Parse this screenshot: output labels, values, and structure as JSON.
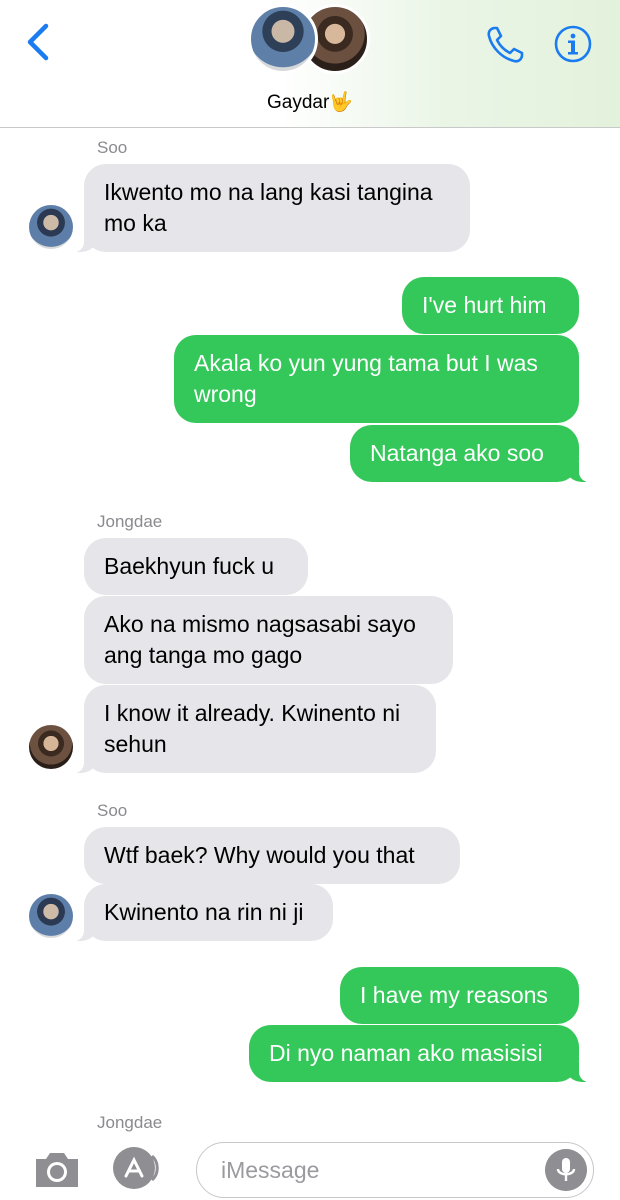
{
  "header": {
    "conversation_title": "Gaydar🤟",
    "accent_color": "#1a7cf0",
    "back_icon": "chevron-left-icon",
    "call_icon": "phone-icon",
    "details_icon": "info-icon"
  },
  "messages": [
    {
      "sender": "Soo"
    },
    {
      "text": "Ikwento mo na lang kasi tangina\nmo ka"
    },
    {
      "text": "I've hurt him"
    },
    {
      "text": "Akala ko yun yung tama but I was\nwrong"
    },
    {
      "text": "Natanga ako soo"
    },
    {
      "sender": "Jongdae"
    },
    {
      "text": "Baekhyun fuck u"
    },
    {
      "text": "Ako na mismo nagsasabi sayo\nang tanga mo gago"
    },
    {
      "text": "I know it already. Kwinento ni\nsehun"
    },
    {
      "sender": "Soo"
    },
    {
      "text": "Wtf baek? Why would you that"
    },
    {
      "text": "Kwinento na rin ni ji"
    },
    {
      "text": "I have my reasons"
    },
    {
      "text": "Di nyo naman ako masisisi"
    },
    {
      "sender": "Jongdae"
    }
  ],
  "composer": {
    "placeholder": "iMessage",
    "camera_icon": "camera-icon",
    "apps_icon": "app-store-icon",
    "mic_icon": "microphone-icon"
  },
  "colors": {
    "incoming_bubble": "#e5e5ea",
    "outgoing_bubble": "#34c759",
    "sender_label": "#8a8a8f"
  }
}
